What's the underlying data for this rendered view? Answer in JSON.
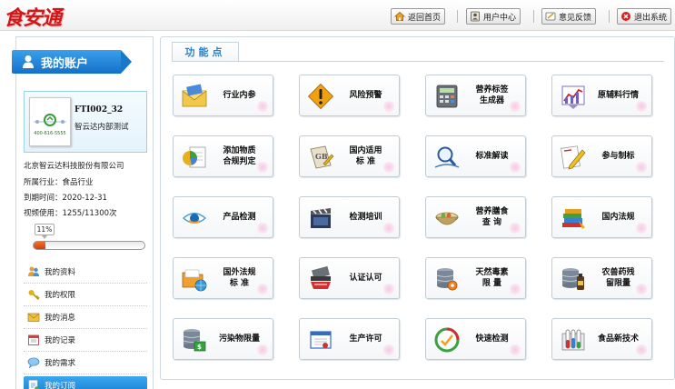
{
  "header": {
    "logo_text": "食安通",
    "buttons": [
      {
        "label": "返回首页",
        "icon": "home-icon"
      },
      {
        "label": "用户中心",
        "icon": "user-center-icon"
      },
      {
        "label": "意见反馈",
        "icon": "feedback-icon"
      },
      {
        "label": "退出系统",
        "icon": "exit-icon"
      }
    ]
  },
  "sidebar": {
    "title": "我的账户",
    "card": {
      "code": "FTI002_32",
      "name": "智云达内部测试",
      "logo_text": "400-616-5555"
    },
    "company": "北京智云达科技股份有限公司",
    "industry": "所属行业：食品行业",
    "expiry": "到期时间：2020-12-31",
    "video_usage": "视频使用：1255/11300次",
    "progress": {
      "label": "11%",
      "value": 0.11
    },
    "menu": [
      {
        "label": "我的资料",
        "icon": "profile-icon"
      },
      {
        "label": "我的权限",
        "icon": "key-icon"
      },
      {
        "label": "我的消息",
        "icon": "mail-icon"
      },
      {
        "label": "我的记录",
        "icon": "calendar-icon"
      },
      {
        "label": "我的需求",
        "icon": "chat-icon"
      },
      {
        "label": "我的订阅",
        "icon": "subscribe-icon",
        "active": true
      }
    ]
  },
  "main": {
    "tab_title": "功能点",
    "tiles": [
      {
        "label": "行业内参",
        "icon": "envelope-icon"
      },
      {
        "label": "风险预警",
        "icon": "warning-icon"
      },
      {
        "label": "营养标签\n生成器",
        "icon": "calculator-icon"
      },
      {
        "label": "原辅料行情",
        "icon": "trend-chart-icon"
      },
      {
        "label": "添加物质\n合规判定",
        "icon": "pie-chart-icon"
      },
      {
        "label": "国内适用\n标  准",
        "icon": "gb-standard-icon"
      },
      {
        "label": "标准解读",
        "icon": "magnifier-icon"
      },
      {
        "label": "参与制标",
        "icon": "pencil-icon"
      },
      {
        "label": "产品检测",
        "icon": "eye-icon"
      },
      {
        "label": "检测培训",
        "icon": "clapper-icon"
      },
      {
        "label": "营养膳食\n查  询",
        "icon": "food-bowl-icon"
      },
      {
        "label": "国内法规",
        "icon": "books-icon"
      },
      {
        "label": "国外法规\n标  准",
        "icon": "folder-globe-icon"
      },
      {
        "label": "认证认可",
        "icon": "certificate-icon"
      },
      {
        "label": "天然毒素\n限  量",
        "icon": "database-gear-icon"
      },
      {
        "label": "农兽药残\n留限量",
        "icon": "database-bottle-icon"
      },
      {
        "label": "污染物限量",
        "icon": "database-money-icon"
      },
      {
        "label": "生产许可",
        "icon": "license-icon"
      },
      {
        "label": "快速检测",
        "icon": "quick-test-icon"
      },
      {
        "label": "食品新技术",
        "icon": "test-tube-icon"
      }
    ]
  }
}
